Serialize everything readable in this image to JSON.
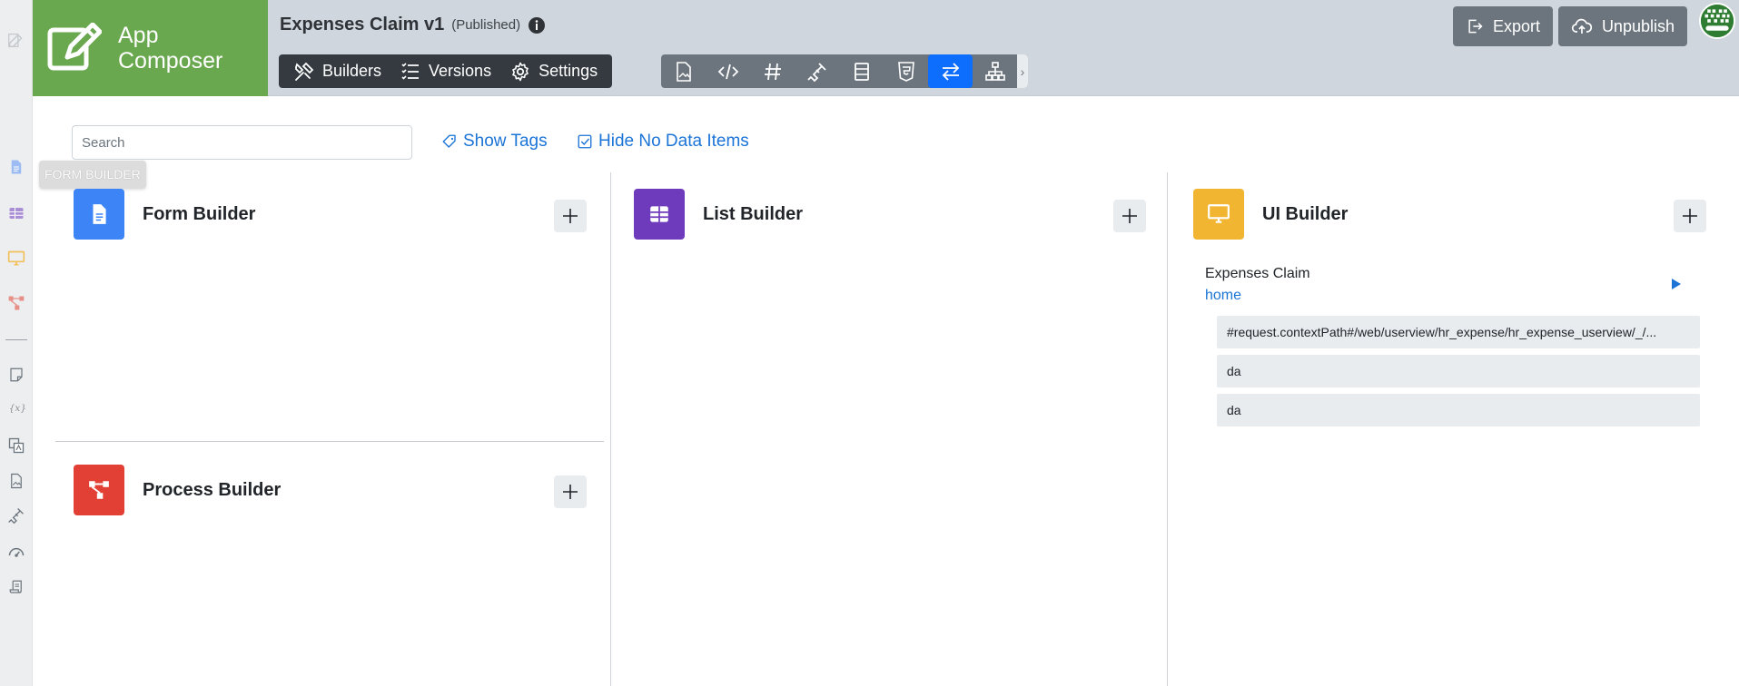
{
  "brand": {
    "line1": "App",
    "line2": "Composer"
  },
  "app": {
    "name": "Expenses Claim v1",
    "status": "(Published)"
  },
  "nav_tabs": [
    {
      "label": "Builders",
      "icon": "builders-icon"
    },
    {
      "label": "Versions",
      "icon": "versions-icon"
    },
    {
      "label": "Settings",
      "icon": "gear-icon"
    }
  ],
  "toolbar_icons": [
    "image-icon",
    "code-icon",
    "hash-icon",
    "plugin-icon",
    "table-icon",
    "html5-icon",
    "swap-icon",
    "sitemap-icon"
  ],
  "toolbar_active": "swap-icon",
  "header_buttons": {
    "export": "Export",
    "unpublish": "Unpublish"
  },
  "tooltip": "FORM BUILDER",
  "search": {
    "placeholder": "Search",
    "value": ""
  },
  "toggles": {
    "show_tags": "Show Tags",
    "hide_no_data": "Hide No Data Items"
  },
  "builders": {
    "form": {
      "title": "Form Builder",
      "color": "#3d85f7"
    },
    "list": {
      "title": "List Builder",
      "color": "#6f3bbd"
    },
    "ui": {
      "title": "UI Builder",
      "color": "#f2b531"
    },
    "process": {
      "title": "Process Builder",
      "color": "#e24035"
    }
  },
  "ui_items": [
    {
      "title": "Expenses Claim",
      "link": "home",
      "rows": [
        "#request.contextPath#/web/userview/hr_expense/hr_expense_userview/_/...",
        "da",
        "da"
      ]
    }
  ],
  "colors": {
    "brand_green": "#6aa84f",
    "header_bg": "#cfd6de",
    "active_blue": "#0d6efd",
    "link_blue": "#1b74d6"
  }
}
